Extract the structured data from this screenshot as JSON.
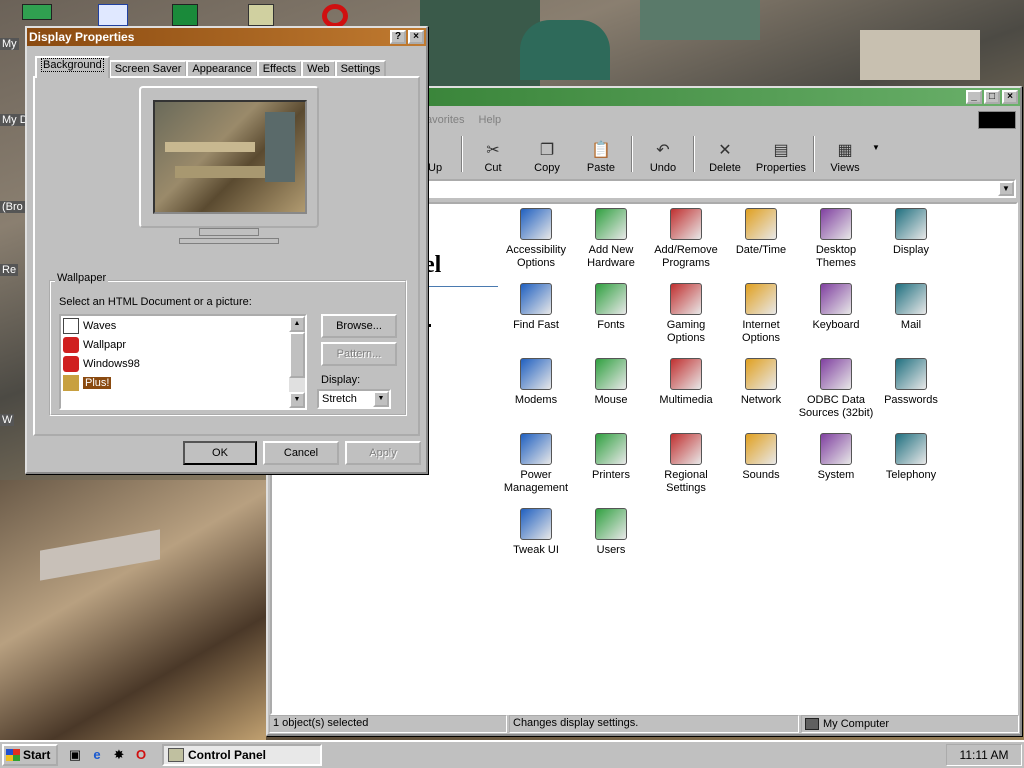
{
  "desktop": {
    "icons": [
      {
        "name": "network-icon",
        "label": "My"
      },
      {
        "name": "mydocs-icon",
        "label": "My D"
      },
      {
        "name": "recycle-icon",
        "label": "Re"
      },
      {
        "name": "browse-icon",
        "label": "(Bro"
      },
      {
        "name": "w-icon",
        "label": "W"
      }
    ]
  },
  "control_panel": {
    "menus": [
      "avorites",
      "Help"
    ],
    "toolbar": [
      {
        "label": "Up",
        "icon": "up-icon"
      },
      {
        "label": "Cut",
        "icon": "cut-icon"
      },
      {
        "label": "Copy",
        "icon": "copy-icon"
      },
      {
        "label": "Paste",
        "icon": "paste-icon"
      },
      {
        "label": "Undo",
        "icon": "undo-icon"
      },
      {
        "label": "Delete",
        "icon": "delete-icon"
      },
      {
        "label": "Properties",
        "icon": "properties-icon"
      },
      {
        "label": "Views",
        "icon": "views-icon"
      }
    ],
    "panel_title": "el",
    "icons": [
      {
        "label": "Accessibility Options",
        "icon": "accessibility-icon"
      },
      {
        "label": "Add New Hardware",
        "icon": "add-hardware-icon"
      },
      {
        "label": "Add/Remove Programs",
        "icon": "add-remove-programs-icon"
      },
      {
        "label": "Date/Time",
        "icon": "date-time-icon"
      },
      {
        "label": "Desktop Themes",
        "icon": "desktop-themes-icon"
      },
      {
        "label": "Display",
        "icon": "display-icon"
      },
      {
        "label": "Find Fast",
        "icon": "find-fast-icon"
      },
      {
        "label": "Fonts",
        "icon": "fonts-icon"
      },
      {
        "label": "Gaming Options",
        "icon": "gaming-icon"
      },
      {
        "label": "Internet Options",
        "icon": "internet-icon"
      },
      {
        "label": "Keyboard",
        "icon": "keyboard-icon"
      },
      {
        "label": "Mail",
        "icon": "mail-icon"
      },
      {
        "label": "Modems",
        "icon": "modems-icon"
      },
      {
        "label": "Mouse",
        "icon": "mouse-icon"
      },
      {
        "label": "Multimedia",
        "icon": "multimedia-icon"
      },
      {
        "label": "Network",
        "icon": "network-icon"
      },
      {
        "label": "ODBC Data Sources (32bit)",
        "icon": "odbc-icon"
      },
      {
        "label": "Passwords",
        "icon": "passwords-icon"
      },
      {
        "label": "Power Management",
        "icon": "power-icon"
      },
      {
        "label": "Printers",
        "icon": "printers-icon"
      },
      {
        "label": "Regional Settings",
        "icon": "regional-icon"
      },
      {
        "label": "Sounds",
        "icon": "sounds-icon"
      },
      {
        "label": "System",
        "icon": "system-icon"
      },
      {
        "label": "Telephony",
        "icon": "telephony-icon"
      },
      {
        "label": "Tweak UI",
        "icon": "tweakui-icon"
      },
      {
        "label": "Users",
        "icon": "users-icon"
      }
    ],
    "status": {
      "left": "1 object(s) selected",
      "middle": "Changes display settings.",
      "right": "My Computer"
    }
  },
  "display_properties": {
    "title": "Display Properties",
    "help_btn": "?",
    "close_btn": "×",
    "tabs": [
      "Background",
      "Screen Saver",
      "Appearance",
      "Effects",
      "Web",
      "Settings"
    ],
    "wallpaper_group": "Wallpaper",
    "select_label": "Select an HTML Document or a picture:",
    "wallpapers": [
      "Waves",
      "Wallpapr",
      "Windows98",
      "Plus!"
    ],
    "selected_wallpaper": "Plus!",
    "browse": "Browse...",
    "pattern": "Pattern...",
    "display_label": "Display:",
    "display_value": "Stretch",
    "ok": "OK",
    "cancel": "Cancel",
    "apply": "Apply"
  },
  "taskbar": {
    "start": "Start",
    "task": "Control Panel",
    "clock": "11:11 AM"
  },
  "colors": {
    "selection": "#8a4a10",
    "active_title": "#8a4a10",
    "inactive_title": "#2e7a2e"
  }
}
